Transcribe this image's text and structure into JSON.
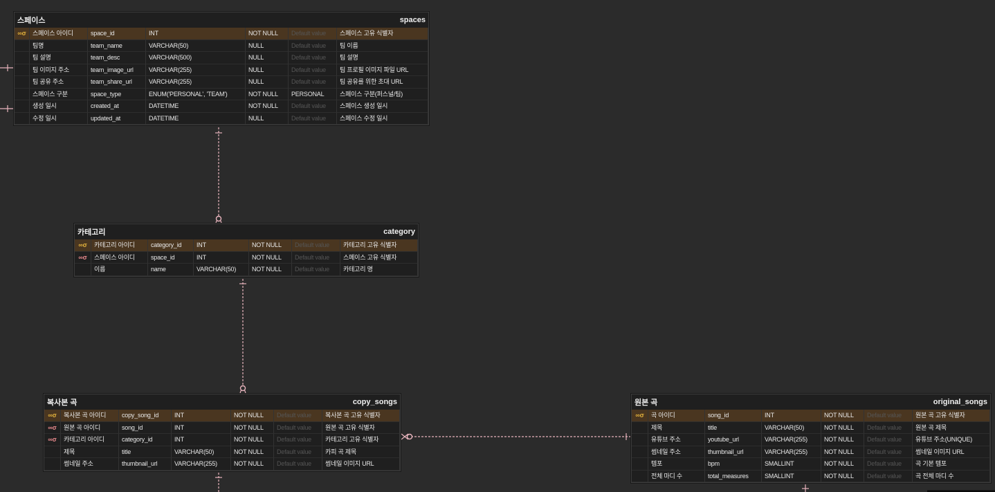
{
  "colors": {
    "background": "#2b2b2b",
    "table_background": "#1f1f1f",
    "primary_key_row": "#4a3620",
    "primary_key_icon": "#e3b23c",
    "foreign_key_icon": "#e8898c",
    "relation_line": "#e8b4bd"
  },
  "icons": {
    "primary_key": "key-icon",
    "foreign_key": "key-icon"
  },
  "tables": [
    {
      "id": "spaces",
      "logical": "스페이스",
      "physical": "spaces",
      "columns": [
        {
          "key": "pk",
          "logical": "스페이스 아이디",
          "physical": "space_id",
          "type": "INT",
          "nullable": "NOT NULL",
          "default": "Default value",
          "default_set": false,
          "comment": "스페이스 고유 식별자"
        },
        {
          "key": "",
          "logical": "팀명",
          "physical": "team_name",
          "type": "VARCHAR(50)",
          "nullable": "NULL",
          "default": "Default value",
          "default_set": false,
          "comment": "팀 이름"
        },
        {
          "key": "",
          "logical": "팀 설명",
          "physical": "team_desc",
          "type": "VARCHAR(500)",
          "nullable": "NULL",
          "default": "Default value",
          "default_set": false,
          "comment": "팀 설명"
        },
        {
          "key": "",
          "logical": "팀 이미지 주소",
          "physical": "team_image_url",
          "type": "VARCHAR(255)",
          "nullable": "NULL",
          "default": "Default value",
          "default_set": false,
          "comment": "팀 프로필 이미지 파일 URL"
        },
        {
          "key": "",
          "logical": "팀 공유 주소",
          "physical": "team_share_url",
          "type": "VARCHAR(255)",
          "nullable": "NULL",
          "default": "Default value",
          "default_set": false,
          "comment": "팀 공유를 위한 초대 URL"
        },
        {
          "key": "",
          "logical": "스페이스 구분",
          "physical": "space_type",
          "type": "ENUM('PERSONAL', 'TEAM')",
          "nullable": "NOT NULL",
          "default": "PERSONAL",
          "default_set": true,
          "comment": "스페이스 구분(퍼스널/팀)"
        },
        {
          "key": "",
          "logical": "생성 일시",
          "physical": "created_at",
          "type": "DATETIME",
          "nullable": "NOT NULL",
          "default": "Default value",
          "default_set": false,
          "comment": "스페이스 생성 일시"
        },
        {
          "key": "",
          "logical": "수정 일시",
          "physical": "updated_at",
          "type": "DATETIME",
          "nullable": "NULL",
          "default": "Default value",
          "default_set": false,
          "comment": "스페이스 수정 일시"
        }
      ]
    },
    {
      "id": "category",
      "logical": "카테고리",
      "physical": "category",
      "columns": [
        {
          "key": "pk",
          "logical": "카테고리 아이디",
          "physical": "category_id",
          "type": "INT",
          "nullable": "NOT NULL",
          "default": "Default value",
          "default_set": false,
          "comment": "카테고리 고유 식별자"
        },
        {
          "key": "fk",
          "logical": "스페이스 아이디",
          "physical": "space_id",
          "type": "INT",
          "nullable": "NOT NULL",
          "default": "Default value",
          "default_set": false,
          "comment": "스페이스 고유 식별자"
        },
        {
          "key": "",
          "logical": "이름",
          "physical": "name",
          "type": "VARCHAR(50)",
          "nullable": "NOT NULL",
          "default": "Default value",
          "default_set": false,
          "comment": "카테고리 명"
        }
      ]
    },
    {
      "id": "copy_songs",
      "logical": "복사본 곡",
      "physical": "copy_songs",
      "columns": [
        {
          "key": "pk",
          "logical": "복사본 곡 아이디",
          "physical": "copy_song_id",
          "type": "INT",
          "nullable": "NOT NULL",
          "default": "Default value",
          "default_set": false,
          "comment": "복사본 곡 고유 식별자"
        },
        {
          "key": "fk",
          "logical": "원본 곡 아이디",
          "physical": "song_id",
          "type": "INT",
          "nullable": "NOT NULL",
          "default": "Default value",
          "default_set": false,
          "comment": "원본 곡 고유 식별자"
        },
        {
          "key": "fk",
          "logical": "카테고리 아이디",
          "physical": "category_id",
          "type": "INT",
          "nullable": "NOT NULL",
          "default": "Default value",
          "default_set": false,
          "comment": "카테고리 고유 식별자"
        },
        {
          "key": "",
          "logical": "제목",
          "physical": "title",
          "type": "VARCHAR(50)",
          "nullable": "NOT NULL",
          "default": "Default value",
          "default_set": false,
          "comment": "카피 곡 제목"
        },
        {
          "key": "",
          "logical": "썸네일 주소",
          "physical": "thumbnail_url",
          "type": "VARCHAR(255)",
          "nullable": "NOT NULL",
          "default": "Default value",
          "default_set": false,
          "comment": "썸네일 이미지 URL"
        }
      ]
    },
    {
      "id": "original_songs",
      "logical": "원본 곡",
      "physical": "original_songs",
      "columns": [
        {
          "key": "pk",
          "logical": "곡 아이디",
          "physical": "song_id",
          "type": "INT",
          "nullable": "NOT NULL",
          "default": "Default value",
          "default_set": false,
          "comment": "원본 곡 고유 식별자"
        },
        {
          "key": "",
          "logical": "제목",
          "physical": "title",
          "type": "VARCHAR(50)",
          "nullable": "NOT NULL",
          "default": "Default value",
          "default_set": false,
          "comment": "원본 곡 제목"
        },
        {
          "key": "",
          "logical": "유튜브 주소",
          "physical": "youtube_url",
          "type": "VARCHAR(255)",
          "nullable": "NOT NULL",
          "default": "Default value",
          "default_set": false,
          "comment": "유튜브 주소(UNIQUE)"
        },
        {
          "key": "",
          "logical": "썸네일 주소",
          "physical": "thumbnail_url",
          "type": "VARCHAR(255)",
          "nullable": "NOT NULL",
          "default": "Default value",
          "default_set": false,
          "comment": "썸네일 이미지 URL"
        },
        {
          "key": "",
          "logical": "템포",
          "physical": "bpm",
          "type": "SMALLINT",
          "nullable": "NOT NULL",
          "default": "Default value",
          "default_set": false,
          "comment": "곡 기본 템포"
        },
        {
          "key": "",
          "logical": "전체 마디 수",
          "physical": "total_measures",
          "type": "SMALLINT",
          "nullable": "NOT NULL",
          "default": "Default value",
          "default_set": false,
          "comment": "곡 전체 마디 수"
        }
      ]
    }
  ]
}
